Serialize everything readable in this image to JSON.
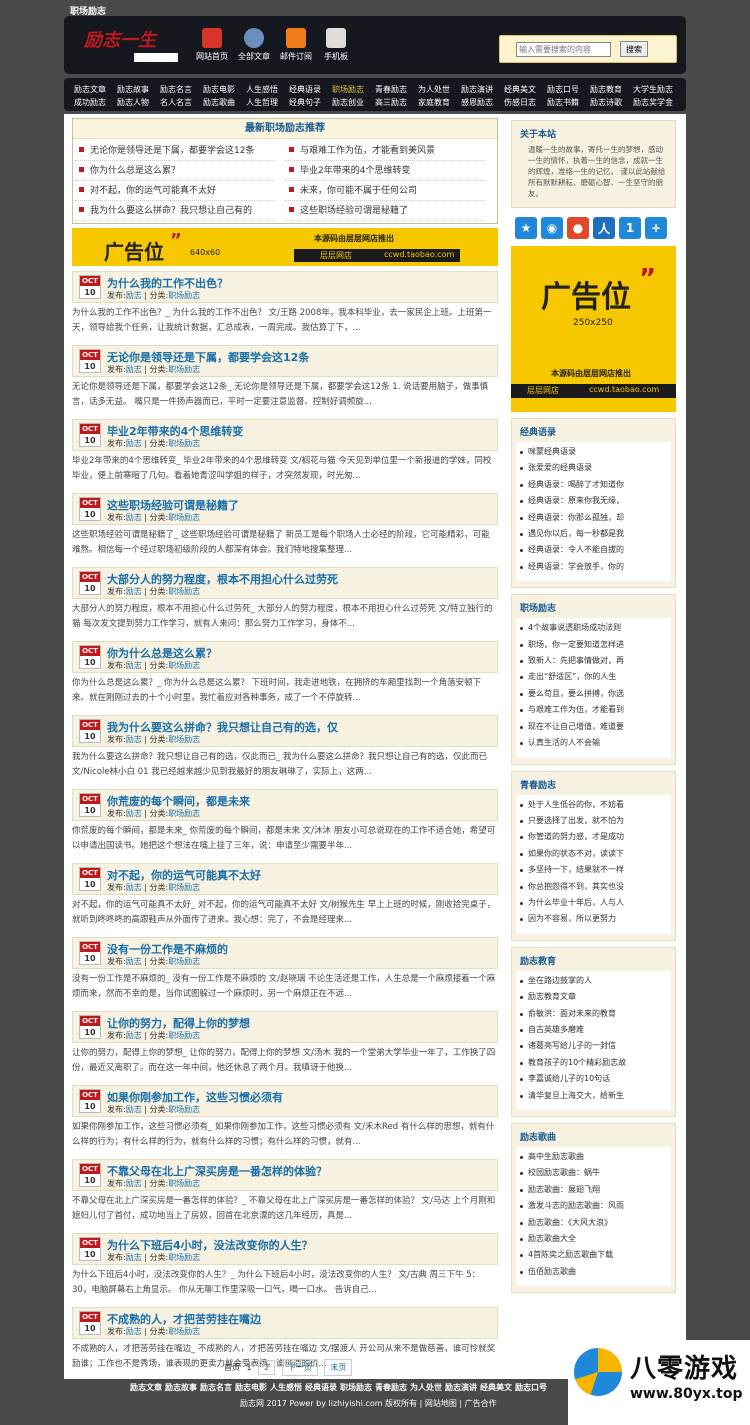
{
  "page_title": "职场励志",
  "logo": {
    "text": "励志一生"
  },
  "header_nav": [
    {
      "label": "网站首页",
      "icon": "home-icon",
      "color": "#d9342b"
    },
    {
      "label": "全部文章",
      "icon": "globe-icon",
      "color": "#6a8fbf"
    },
    {
      "label": "邮件订阅",
      "icon": "rss-icon",
      "color": "#f07d1a"
    },
    {
      "label": "手机板",
      "icon": "phone-icon",
      "color": "#dddddd"
    }
  ],
  "search": {
    "placeholder": "输入需要搜索的内容",
    "button": "搜索"
  },
  "nav_row1": [
    "励志文章",
    "励志故事",
    "励志名言",
    "励志电影",
    "人生感悟",
    "经典语录",
    "职场励志",
    "青春励志",
    "为人处世",
    "励志演讲",
    "经典美文",
    "励志口号",
    "励志教育",
    "大学生励志"
  ],
  "nav_row2": [
    "成功励志",
    "励志人物",
    "名人名言",
    "励志歌曲",
    "人生哲理",
    "经典句子",
    "励志创业",
    "高三励志",
    "家庭教育",
    "感恩励志",
    "伤感日志",
    "励志书籍",
    "励志诗歌",
    "励志奖学金"
  ],
  "nav_active": "职场励志",
  "recommend": {
    "title": "最新职场励志推荐",
    "items": [
      "无论你是领导还是下属，都要学会这12条",
      "与艰难工作为伍，才能看到美风景",
      "你为什么总是这么累？",
      "毕业2年带来的4个思维转变",
      "对不起，你的运气可能真不太好",
      "未来，你可能不属于任何公司",
      "我为什么要这么拼命？我只想让自己有的",
      "这些职场经验可谓是秘籍了"
    ]
  },
  "ad_banner": {
    "label": "广告位",
    "size": "640x60",
    "line1": "本源码由层层网店推出",
    "line2a": "层层网店",
    "line2b": "ccwd.taobao.com"
  },
  "ad_side": {
    "label": "广告位",
    "size": "250x250",
    "line1": "本源码由层层网店推出",
    "line2a": "层层网店",
    "line2b": "ccwd.taobao.com"
  },
  "posts": [
    {
      "title": "为什么我的工作不出色？",
      "month": "OCT",
      "day": "10",
      "author": "励志",
      "cat": "职场励志",
      "excerpt": "为什么我的工作不出色？_ 为什么我的工作不出色？ 文/王路 2008年，我本科毕业，去一家民企上班。上班第一天，领导给我个任务，让我统计数据，汇总成表，一周完成。我估算了下，..."
    },
    {
      "title": "无论你是领导还是下属，都要学会这12条",
      "month": "OCT",
      "day": "10",
      "author": "励志",
      "cat": "职场励志",
      "excerpt": "无论你是领导还是下属，都要学会这12条_ 无论你是领导还是下属，都要学会这12条 1. 说话要用脑子，做事慎言，话多无益。 嘴只是一件扬声器而已，平时一定要注意监督、控制好调频旋..."
    },
    {
      "title": "毕业2年带来的4个思维转变",
      "month": "OCT",
      "day": "10",
      "author": "励志",
      "cat": "职场励志",
      "excerpt": "毕业2年带来的4个思维转变_ 毕业2年带来的4个思维转变 文/榈花与猫 今天见到单位里一个新报道的学妹，同校毕业，便上前寒暄了几句。看着她青涩叫学姐的样子，才突然发现，时光匆..."
    },
    {
      "title": "这些职场经验可谓是秘籍了",
      "month": "OCT",
      "day": "10",
      "author": "励志",
      "cat": "职场励志",
      "excerpt": "这些职场经验可谓是秘籍了_ 这些职场经验可谓是秘籍了 新员工是每个职场人士必经的阶段，它可能精彩，可能难熬。相信每一个经过职场初级阶段的人都深有体会。我们特地搜集整理..."
    },
    {
      "title": "大部分人的努力程度，根本不用担心什么过劳死",
      "month": "OCT",
      "day": "10",
      "author": "励志",
      "cat": "职场励志",
      "excerpt": "大部分人的努力程度，根本不用担心什么过劳死_ 大部分人的努力程度，根本不用担心什么过劳死 文/特立独行的猫 每次发文提到努力工作学习，就有人来问：那么努力工作学习，身体不..."
    },
    {
      "title": "你为什么总是这么累？",
      "month": "OCT",
      "day": "10",
      "author": "励志",
      "cat": "职场励志",
      "excerpt": "你为什么总是这么累？_ 你为什么总是这么累？ 下班时间，我走进地铁，在拥挤的车厢里找到一个角落安顿下来。就在刚刚过去的十个小时里，我忙着应对各种事务，成了一个不停旋转..."
    },
    {
      "title": "我为什么要这么拼命？我只想让自己有的选，仅",
      "month": "OCT",
      "day": "10",
      "author": "励志",
      "cat": "职场励志",
      "excerpt": "我为什么要这么拼命？我只想让自己有的选，仅此而已_ 我为什么要这么拼命？我只想让自己有的选，仅此而已 文/Nicole林小白 01 我已经越来越少见到我最好的朋友琳琳了，实际上，这两..."
    },
    {
      "title": "你荒废的每个瞬间，都是未来",
      "month": "OCT",
      "day": "10",
      "author": "励志",
      "cat": "职场励志",
      "excerpt": "你荒废的每个瞬间，都是未来_ 你荒废的每个瞬间，都是未来 文/沐沐 朋友小可总说现在的工作不适合她，希望可以申请出国读书。她把这个想法在嘴上挂了三年，说：申请至少需要半年..."
    },
    {
      "title": "对不起，你的运气可能真不太好",
      "month": "OCT",
      "day": "10",
      "author": "励志",
      "cat": "职场励志",
      "excerpt": "对不起，你的运气可能真不太好_ 对不起，你的运气可能真不太好 文/树猴先生 早上上班的时候，刚收拾完桌子，就听到咚咚咚的高跟鞋声从外面传了进来。我心想：完了，不会是经理来..."
    },
    {
      "title": "没有一份工作是不麻烦的",
      "month": "OCT",
      "day": "10",
      "author": "励志",
      "cat": "职场励志",
      "excerpt": "没有一份工作是不麻烦的_ 没有一份工作是不麻烦的 文/赵晓璃 不论生活还是工作，人生总是一个麻烦接着一个麻烦而来，然而不幸的是，当你试图躲过一个麻烦时，另一个麻烦正在不远..."
    },
    {
      "title": "让你的努力，配得上你的梦想",
      "month": "OCT",
      "day": "10",
      "author": "励志",
      "cat": "职场励志",
      "excerpt": "让你的努力，配得上你的梦想_ 让你的努力，配得上你的梦想 文/汤木 我的一个堂弟大学毕业一年了，工作换了四份，最近又离职了。而在这一年中间，他还休息了两个月。我嗔讶于他换..."
    },
    {
      "title": "如果你刚参加工作，这些习惯必须有",
      "month": "OCT",
      "day": "10",
      "author": "励志",
      "cat": "职场励志",
      "excerpt": "如果你刚参加工作，这些习惯必须有_ 如果你刚参加工作，这些习惯必须有 文/禾木Red 有什么样的思想，就有什么样的行为；有什么样的行为，就有什么样的习惯；有什么样的习惯，就有..."
    },
    {
      "title": "不靠父母在北上广深买房是一番怎样的体验？",
      "month": "OCT",
      "day": "10",
      "author": "励志",
      "cat": "职场励志",
      "excerpt": "不靠父母在北上广深买房是一番怎样的体验？_ 不靠父母在北上广深买房是一番怎样的体验？ 文/马达 上个月刚和媳妇儿付了首付，成功地当上了房奴，回首在北京漂的这几年经历，真是..."
    },
    {
      "title": "为什么下班后4小时，没法改变你的人生？",
      "month": "OCT",
      "day": "10",
      "author": "励志",
      "cat": "职场励志",
      "excerpt": "为什么下班后4小时，没法改变你的人生？_ 为什么下班后4小时，没法改变你的人生？ 文/古典 周三下午 5：30，电脑屏幕右上角显示。 你从无聊工作里深吸一口气，喝一口水。 告诉自己..."
    },
    {
      "title": "不成熟的人，才把苦劳挂在嘴边",
      "month": "OCT",
      "day": "10",
      "author": "励志",
      "cat": "职场励志",
      "excerpt": "不成熟的人，才把苦劳挂在嘴边_ 不成熟的人，才把苦劳挂在嘴边 文/摆渡人 开公司从来不是做慈善，谁可怜就奖励谁；工作也不是秀场，谁表现的更卖力就会受表扬。谁创造的价..."
    }
  ],
  "post_meta_labels": {
    "by": "发布:",
    "cat": "分类:"
  },
  "pager": {
    "text": "首页",
    "current": "1",
    "page2": "2",
    "next": "下一页",
    "last": "末页"
  },
  "about": {
    "title": "关于本站",
    "text": "温暖一生的故事，寄托一生的梦想，感动一生的情怀，执着一生的信念，成就一生的辉煌，准络一生的记忆。 谨以此站献给所有默默耕耘、磨砺心智、一生坚守的朋友。"
  },
  "share_icons": [
    {
      "icon": "favorite-star-icon",
      "glyph": "★",
      "color": "#1f88d9"
    },
    {
      "icon": "qzone-icon",
      "glyph": "◉",
      "color": "#1f88d9"
    },
    {
      "icon": "weibo-icon",
      "glyph": "●",
      "color": "#e0482a"
    },
    {
      "icon": "renren-icon",
      "glyph": "人",
      "color": "#1f6fbf"
    },
    {
      "icon": "kaixin-icon",
      "glyph": "1",
      "color": "#1f88d9"
    },
    {
      "icon": "more-share-icon",
      "glyph": "+",
      "color": "#1f88d9"
    }
  ],
  "side_sections": [
    {
      "title": "经典语录",
      "items": [
        "咪蒙经典语录",
        "张爱爱的经典语录",
        "经典语录：喝醉了才知道你",
        "经典语录：原来你我无缘，",
        "经典语录：你那么孤独，却",
        "遇见你以后，每一秒都是我",
        "经典语录：令人不能自拔的",
        "经典语录：学会放手，你的"
      ]
    },
    {
      "title": "职场励志",
      "items": [
        "4个故事说透职场成功法则",
        "职场，你一定要知道怎样进",
        "致新人：先把事情做对，再",
        "走出“舒适区”，你的人生",
        "要么苟且，要么拼搏，你选",
        "与艰难工作为伍，才能看到",
        "现在不让自己增值，难道要",
        "认真生活的人不会输"
      ]
    },
    {
      "title": "青春励志",
      "items": [
        "处于人生低谷的你，不妨看",
        "只要选择了出发，就不怕为",
        "你管道的努力感，才是成功",
        "如果你的状态不对，读读下",
        "多坚持一下，结果就不一样",
        "你总抱怨得不到，其实也没",
        "为什么毕业十年后，人与人",
        "因为不容易，所以更努力"
      ]
    },
    {
      "title": "励志教育",
      "items": [
        "坐在路边鼓掌的人",
        "励志教育文章",
        "俞敏洪：面对未来的教育",
        "自古英雄多磨难",
        "诸葛亮写给儿子的一封信",
        "教育孩子的10个精彩励志故",
        "李嘉诚给儿子的10句话",
        "清华复旦上海交大，给新生"
      ]
    },
    {
      "title": "励志歌曲",
      "items": [
        "高中生励志歌曲",
        "校园励志歌曲：蜗牛",
        "励志歌曲：展翅飞翔",
        "激发斗志的励志歌曲：风雨",
        "励志歌曲：《大风大浪》",
        "励志歌曲大全",
        "4首陈奕之励志歌曲下载",
        "伍佰励志歌曲"
      ]
    }
  ],
  "footer": {
    "links": [
      "励志文章",
      "励志故事",
      "励志名言",
      "励志电影",
      "人生感悟",
      "经典语录",
      "职场励志",
      "青春励志",
      "为人处世",
      "励志演讲",
      "经典美文",
      "励志口号"
    ],
    "copyright": "励志网 2017 Power by lizhiyishi.com 版权所有 | 网站地图 | 广告合作"
  },
  "watermark": {
    "title": "八零游戏",
    "url": "www.80yx.top"
  }
}
